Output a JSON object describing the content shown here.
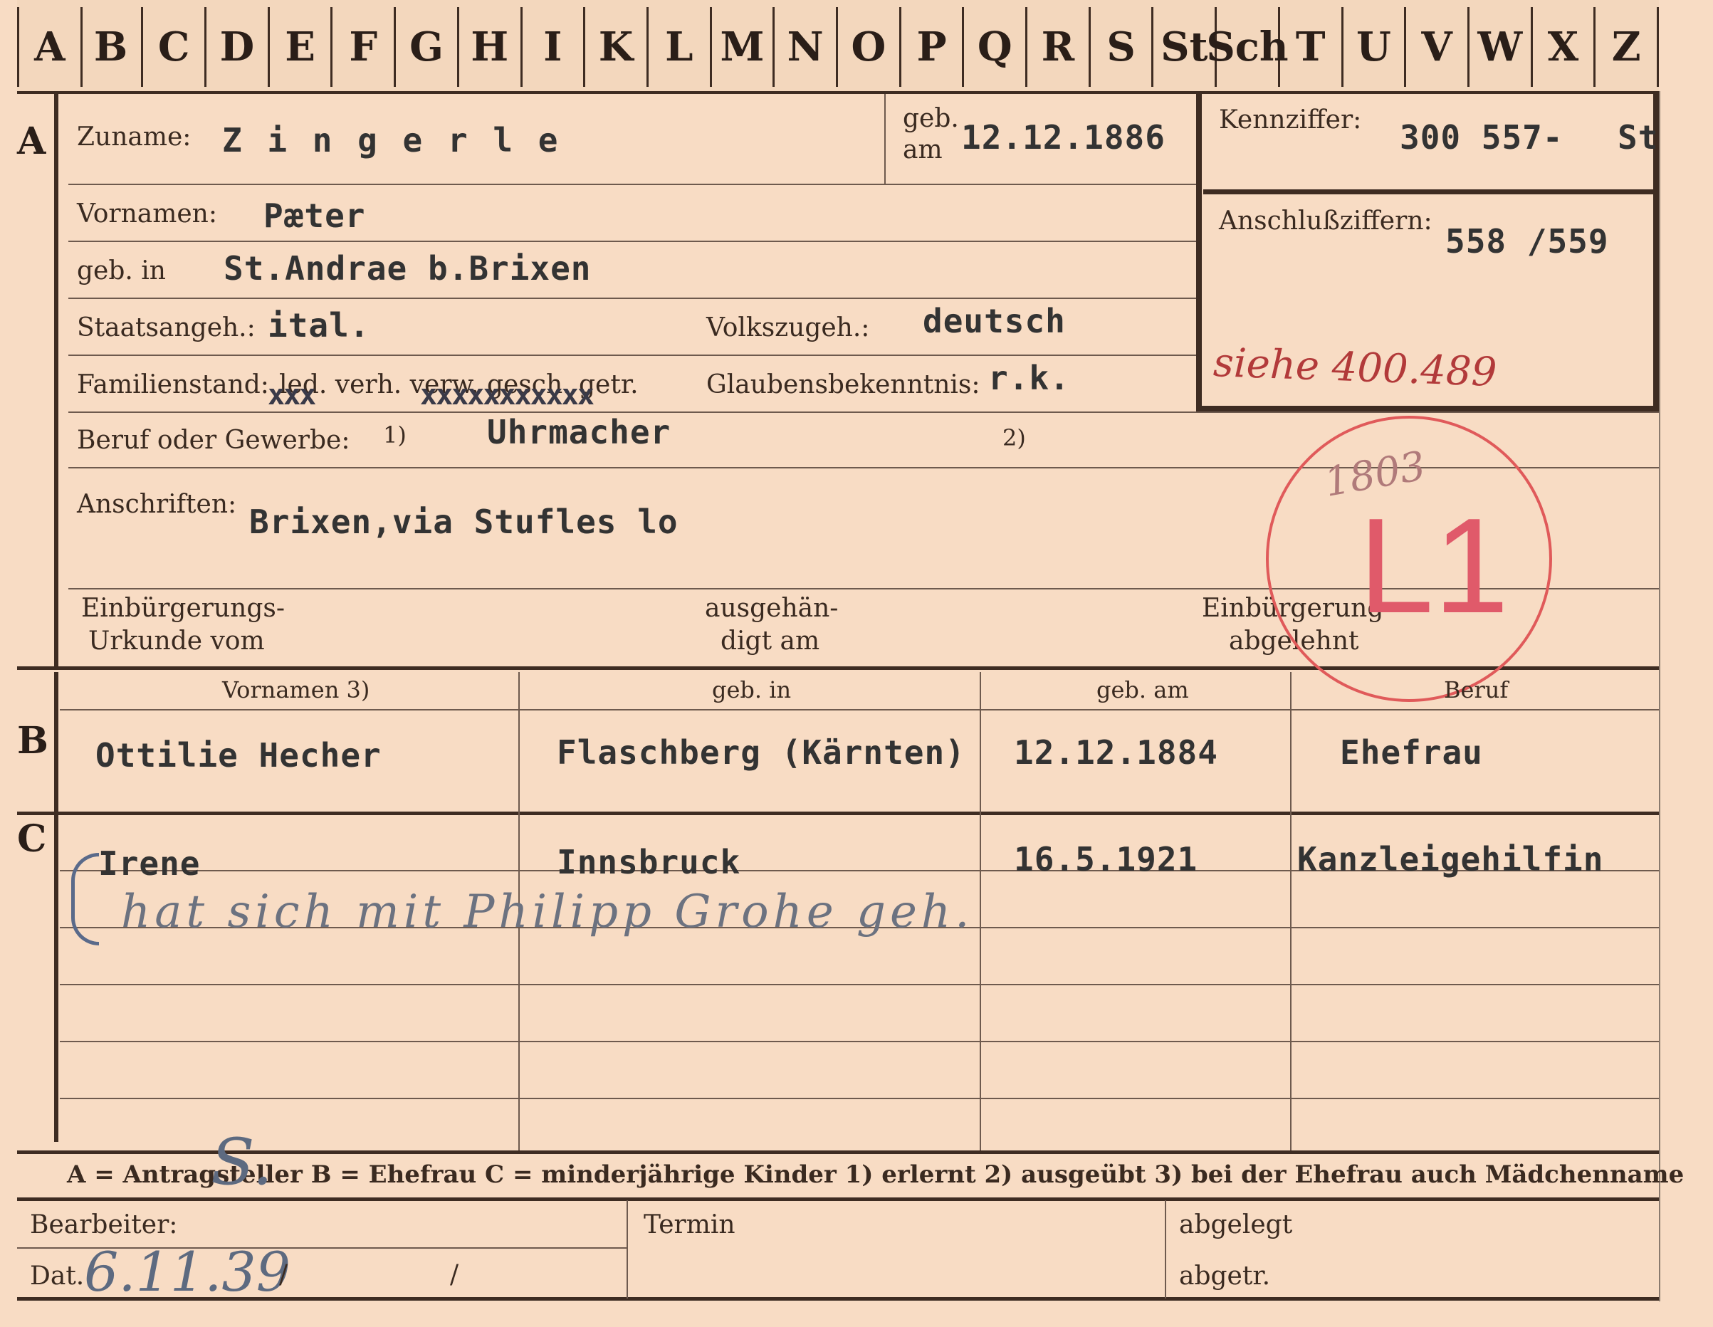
{
  "tabs": [
    "A",
    "B",
    "C",
    "D",
    "E",
    "F",
    "G",
    "H",
    "I",
    "K",
    "L",
    "M",
    "N",
    "O",
    "P",
    "Q",
    "R",
    "S",
    "St",
    "Sch",
    "T",
    "U",
    "V",
    "W",
    "X",
    "Z"
  ],
  "section_a": {
    "marker": "A",
    "surname_label": "Zuname:",
    "surname_value": "Z i n g e r l e",
    "born_on_label_1": "geb.",
    "born_on_label_2": "am",
    "born_on_value": "12.12.1886",
    "kennziffer_label": "Kennziffer:",
    "kennziffer_value": "300 557-",
    "kennziffer_suffix": "St",
    "anschluss_label": "Anschlußziffern:",
    "anschluss_value": "558 /559",
    "anschluss_note": "siehe 400.489",
    "firstname_label": "Vornamen:",
    "firstname_value": "Pæter",
    "birthplace_label": "geb. in",
    "birthplace_value": "St.Andrae b.Brixen",
    "citizenship_label": "Staatsangeh.:",
    "citizenship_value": "ital.",
    "ethnicity_label": "Volkszugeh.:",
    "ethnicity_value": "deutsch",
    "marital_label": "Familienstand:",
    "marital_options": "led. verh. verw. gesch. getr.",
    "marital_strike_1": "xxx",
    "marital_strike_2": "xxxxxxxxxxx",
    "religion_label": "Glaubensbekenntnis:",
    "religion_value": "r.k.",
    "profession_label": "Beruf oder Gewerbe:",
    "profession_note_1": "1)",
    "profession_value": "Uhrmacher",
    "profession_note_2": "2)",
    "address_label": "Anschriften:",
    "address_value": "Brixen,via Stufles lo",
    "naturalization_doc_label_1": "Einbürgerungs-",
    "naturalization_doc_label_2": "Urkunde vom",
    "handed_out_label_1": "ausgehän-",
    "handed_out_label_2": "digt am",
    "naturalization_rejected_label_1": "Einbürgerung",
    "naturalization_rejected_label_2": "abgelehnt",
    "stamp_number": "1803",
    "stamp_mark": "L1"
  },
  "section_b": {
    "marker": "B",
    "headers": [
      "Vornamen 3)",
      "geb. in",
      "geb. am",
      "Beruf"
    ],
    "row": [
      "Ottilie Hecher",
      "Flaschberg (Kärnten)",
      "12.12.1884",
      "Ehefrau"
    ]
  },
  "section_c": {
    "marker": "C",
    "row": [
      "Irene",
      "Innsbruck",
      "16.5.1921",
      "Kanzleigehilfin"
    ],
    "handwritten_note": "hat sich mit Philipp Grohe geh."
  },
  "legend": "A = Antragsteller   B = Ehefrau   C = minderjährige Kinder   1) erlernt   2) ausgeübt   3) bei der Ehefrau auch Mädchenname",
  "footer": {
    "processor_label": "Bearbeiter:",
    "processor_value": "S.",
    "date_label": "Dat.",
    "date_value": "6.11.39",
    "date_slash_1": "/",
    "date_slash_2": "/",
    "deadline_label": "Termin",
    "filed_label": "abgelegt",
    "sent_label": "abgetr."
  }
}
